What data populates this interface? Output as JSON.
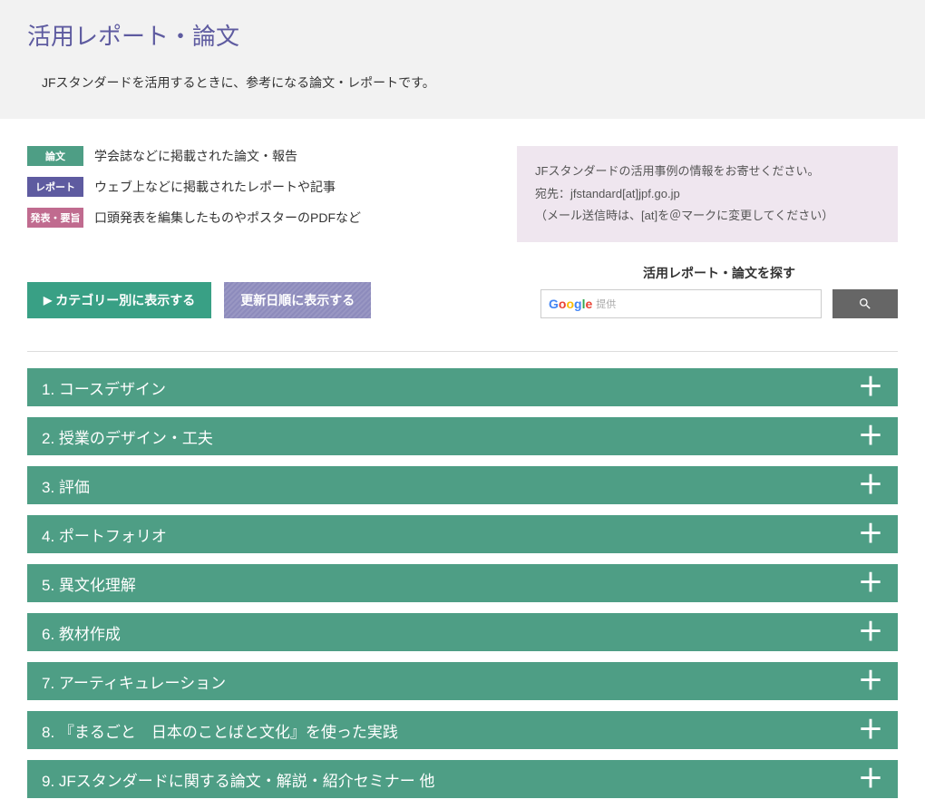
{
  "header": {
    "title": "活用レポート・論文",
    "subtitle": "JFスタンダードを活用するときに、参考になる論文・レポートです。"
  },
  "legend": {
    "items": [
      {
        "tag": "論文",
        "desc": "学会誌などに掲載された論文・報告"
      },
      {
        "tag": "レポート",
        "desc": "ウェブ上などに掲載されたレポートや記事"
      },
      {
        "tag": "発表・要旨",
        "desc": "口頭発表を編集したものやポスターのPDFなど"
      }
    ]
  },
  "notice": {
    "line1": "JFスタンダードの活用事例の情報をお寄せください。",
    "line2": "宛先：jfstandard[at]jpf.go.jp",
    "line3": "（メール送信時は、[at]を＠マークに変更してください）"
  },
  "tabs": {
    "category": "カテゴリー別に表示する",
    "date": "更新日順に表示する"
  },
  "search": {
    "title": "活用レポート・論文を探す",
    "hint": "提供"
  },
  "accordion": {
    "items": [
      {
        "label": "1. コースデザイン"
      },
      {
        "label": "2. 授業のデザイン・工夫"
      },
      {
        "label": "3. 評価"
      },
      {
        "label": "4. ポートフォリオ"
      },
      {
        "label": "5. 異文化理解"
      },
      {
        "label": "6. 教材作成"
      },
      {
        "label": "7. アーティキュレーション"
      },
      {
        "label": "8. 『まるごと　日本のことばと文化』を使った実践"
      },
      {
        "label": "9. JFスタンダードに関する論文・解説・紹介セミナー 他"
      }
    ]
  }
}
